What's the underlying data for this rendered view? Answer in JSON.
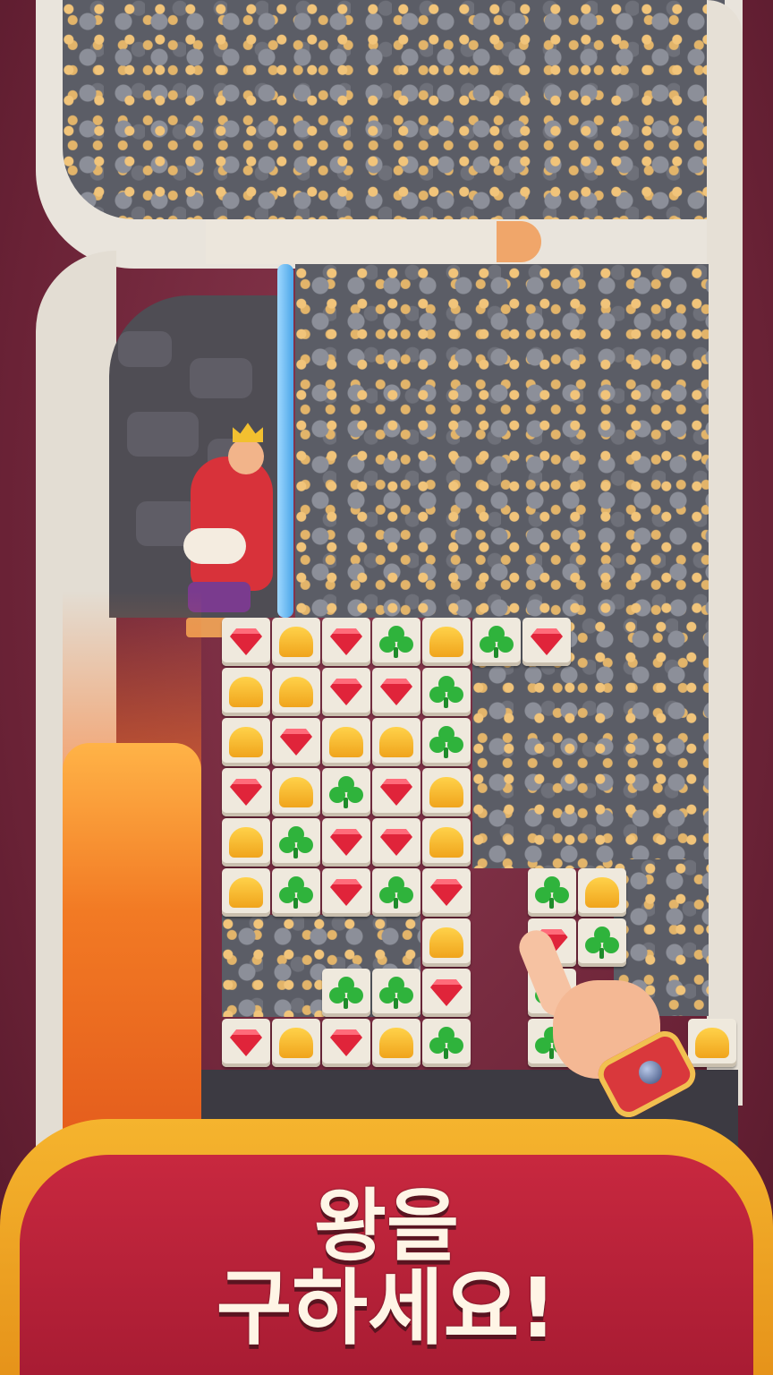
{
  "banner": {
    "line1": "왕을",
    "line2": "구하세요!"
  },
  "board": {
    "tiles": [
      "ruby",
      "crown",
      "ruby",
      "clover",
      "crown",
      "clover",
      "ruby",
      "crown",
      "crown",
      "ruby",
      "ruby",
      "clover",
      "crown",
      "ruby",
      "crown",
      "crown",
      "clover",
      "ruby",
      "crown",
      "clover",
      "ruby",
      "crown",
      "crown",
      "clover",
      "ruby",
      "ruby",
      "crown",
      "crown",
      "clover",
      "ruby",
      "clover",
      "ruby",
      "crown",
      "clover",
      "clover",
      "ruby",
      "ruby",
      "crown",
      "ruby",
      "crown",
      "clover",
      "clover",
      "crown",
      "ruby",
      "clover",
      "clover",
      "clover",
      "crown"
    ]
  },
  "icons": {
    "king": "king-character-icon",
    "pointer": "pointing-hand-icon"
  },
  "colors": {
    "background": "#7a2b3e",
    "banner_gold": "#f5b42e",
    "banner_red": "#c8283f",
    "ruby": "#e0243a",
    "crown": "#ffd24a",
    "clover": "#2fb33c",
    "lava": "#f27a24"
  }
}
